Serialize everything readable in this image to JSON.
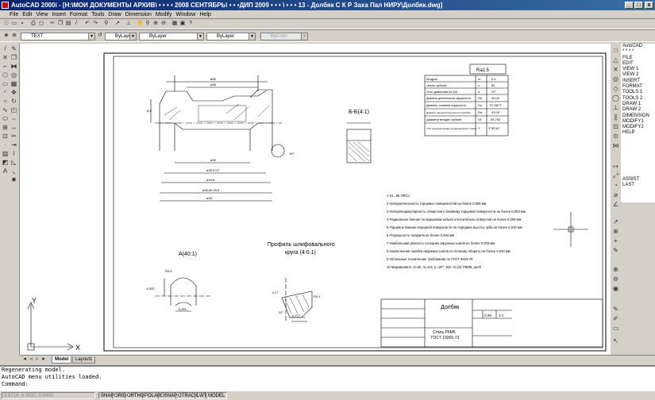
{
  "window": {
    "title": "AutoCAD 2000i - [H:\\МОИ ДОКУМЕНТЫ АРХИВ\\ • • • • 2008 СЕНТЯБРЬ\\ • • •ДИП 2009 • • • \\ • • • 13 - Долбяк С К Р Заха Пал НИРУ\\Долбяк.dwg]",
    "min": "_",
    "max": "□",
    "close": "x"
  },
  "menu": [
    "File",
    "Edit",
    "View",
    "Insert",
    "Format",
    "Tools",
    "Draw",
    "Dimension",
    "Modify",
    "Window",
    "Help"
  ],
  "props_toolbar": {
    "layer": "TEXT",
    "color": "ByLayer",
    "linetype": "ByLayer",
    "lineweight": "ByLayer",
    "plotstyle": "ByColor"
  },
  "screen_menu": [
    "AutoCAD",
    "* * * *",
    "FILE",
    "EDIT",
    "VIEW 1",
    "VIEW 2",
    "INSERT",
    "FORMAT",
    "TOOLS 1",
    "TOOLS 2",
    "DRAW 1",
    "DRAW 2",
    "DIMENSION",
    "MODIFY1",
    "MODIFY2",
    "",
    "HELP",
    "",
    "",
    "",
    "",
    "",
    "",
    "",
    "ASSIST",
    "LAST"
  ],
  "tabs": [
    "Model",
    "Layout1"
  ],
  "command_lines": [
    "Regenerating model.",
    "AutoCAD menu utilities loaded.",
    "Command:"
  ],
  "status": {
    "coords": "3 6218, 4 0032, 0 0000",
    "toggles": [
      "SNAP",
      "GRID",
      "ORTHO",
      "POLAR",
      "OSNAP",
      "OTRACK",
      "LWT",
      "MODEL"
    ]
  },
  "drawing": {
    "ucs_x": "X",
    "ucs_y": "Y",
    "roughness": "Ra2.5",
    "section_label": "Б-Б(4:1)",
    "detail_a": "А(40:1)",
    "profile_title_1": "Профиль шлифовального",
    "profile_title_2": "круга (4:0.1)",
    "dims": {
      "d1": "ø65",
      "d2": "ø58",
      "d3": "ø36",
      "d4": "ø39,9 H7",
      "d5": "ø44,8",
      "d6": "ø46,66 h9,8",
      "d7": "ø18",
      "len": "8,8",
      "ang": "50°",
      "a1": "0,837",
      "a2": "R0,8",
      "a3": "0,901",
      "p1": "0,777",
      "p2": "R0,1",
      "p3": "20°",
      "p4": "0,77"
    },
    "params_table": [
      [
        "Модуль",
        "m",
        "0,5"
      ],
      [
        "Число зубьев",
        "z",
        "80"
      ],
      [
        "Угол давления на Dd",
        "α",
        "20°"
      ],
      [
        "Диаметр делительной окружности",
        "Dd",
        "40,00"
      ],
      [
        "Диаметр основной окружности",
        "Do",
        "37,5877"
      ],
      [
        "Диаметр наружной окружности долбяка",
        "Da",
        "41,03"
      ],
      [
        "Диаметр впадин зубьев",
        "Df",
        "39,762"
      ],
      [
        "Угол подъема впадин шлифовального станка",
        "Y",
        "3°59'44\""
      ]
    ],
    "notes": [
      "1  64...66 HRCэ.",
      "2  Непараллельность торцевых поверхностей не более 0,006 мм",
      "3  Неперпендикулярность отверстия к базовому торцевой поверхности не более 0,003 мм",
      "4  Радиальное биение по вершинам зубьев относительно отверстия не более 0,008 мм",
      "5  Торцевое биение передней поверхности по середине высоты зуба не более 0,010 мм",
      "6  Погрешность профиля не более 0,004 мм",
      "7  Наибольшая разность соседних окружных шагов не более 0,003 мм",
      "8  Накопленная ошибка окружных шагов по полному обороту не более 0,010 мм",
      "9  Остальные технические требования по ГОСТ 9323-79",
      "10  Маркировать: Z=80, m=0,5; α =20°; Dd= 41,03; Р6М5, долб"
    ],
    "title_block": {
      "name": "Долбяк",
      "material_1": "Сталь Р6М5",
      "material_2": "ГОСТ 19265-73",
      "mass": "0,09",
      "scale": "4:1"
    }
  }
}
